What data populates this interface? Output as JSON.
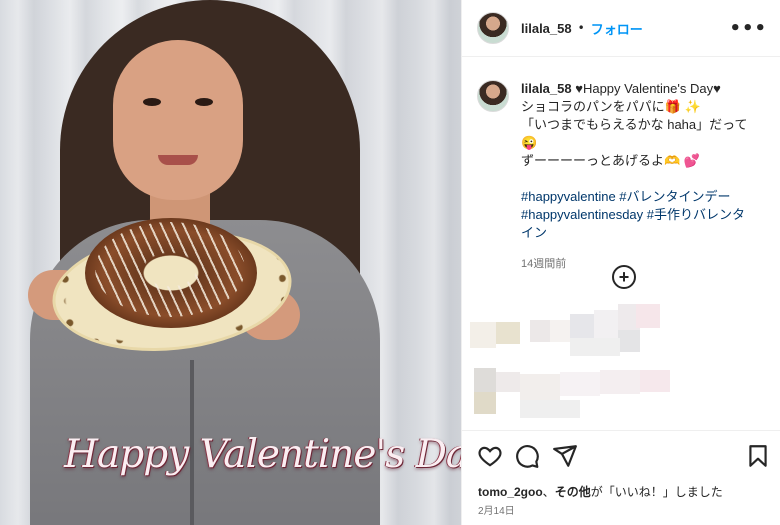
{
  "post": {
    "image_overlay_text": "Happy Valentine's Day"
  },
  "header": {
    "username": "lilala_58",
    "separator": "•",
    "follow_label": "フォロー",
    "more_icon": "more-horizontal-icon"
  },
  "caption": {
    "username": "lilala_58",
    "line1": "♥Happy Valentine's Day♥",
    "line2": "ショコラのパンをパパに🎁 ✨",
    "line3": "「いつまでもらえるかな haha」だって 😜",
    "line4": "ずーーーーっとあげるよ🫶 💕",
    "hashtags_line1": "#happyvalentine #バレンタインデー",
    "hashtags_line2": "#happyvalentinesday #手作りバレンタ",
    "hashtags_line3": "イン",
    "time_ago": "14週間前"
  },
  "add_comment_icon": "add-circle-icon",
  "actions": {
    "like_icon": "heart-icon",
    "comment_icon": "comment-icon",
    "share_icon": "send-icon",
    "save_icon": "bookmark-icon"
  },
  "likes": {
    "username": "tomo_2goo",
    "text_mid": "、",
    "others": "その他",
    "text_end": "が「いいね！」しました"
  },
  "date": "2月14日",
  "colors": {
    "link_blue": "#0095f6",
    "hashtag": "#00376b",
    "muted": "#737373",
    "text": "#262626"
  }
}
